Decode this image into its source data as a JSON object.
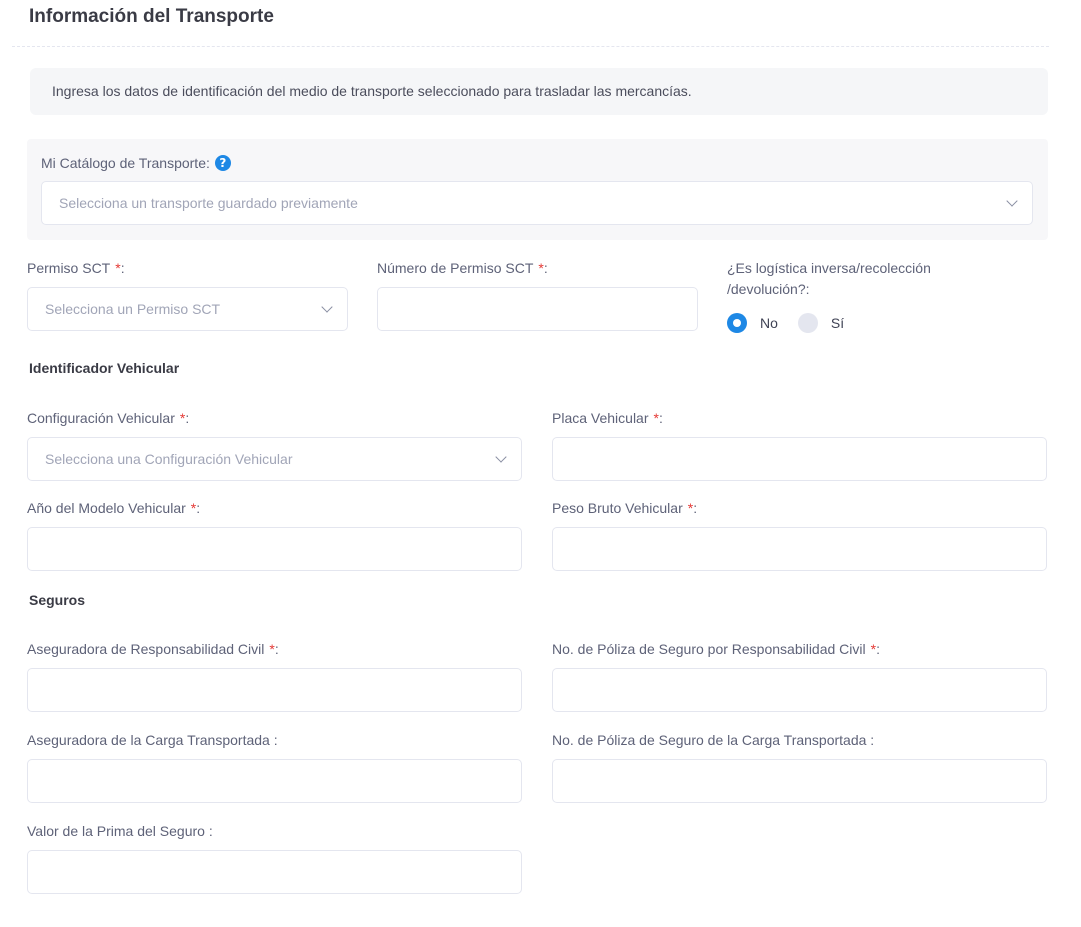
{
  "page": {
    "title": "Información del Transporte"
  },
  "notice": "Ingresa los datos de identificación del medio de transporte seleccionado para trasladar las mercancías.",
  "catalog": {
    "label": "Mi Catálogo de Transporte:",
    "help_icon": "?",
    "placeholder": "Selecciona un transporte guardado previamente"
  },
  "permiso": {
    "label": "Permiso SCT",
    "required_mark": "*",
    "colon": ":",
    "placeholder": "Selecciona un Permiso SCT"
  },
  "numero_permiso": {
    "label": "Número de Permiso SCT",
    "required_mark": "*",
    "colon": ":",
    "value": ""
  },
  "logistica": {
    "label_line1": "¿Es logística inversa/recolección",
    "label_line2": "/devolución?:",
    "options": [
      {
        "label": "No",
        "checked": true
      },
      {
        "label": "Sí",
        "checked": false
      }
    ]
  },
  "identificador": {
    "section_title": "Identificador Vehicular",
    "configuracion": {
      "label": "Configuración Vehicular",
      "required_mark": "*",
      "colon": ":",
      "placeholder": "Selecciona una Configuración Vehicular"
    },
    "placa": {
      "label": "Placa Vehicular",
      "required_mark": "*",
      "colon": ":",
      "value": ""
    },
    "anio": {
      "label": "Año del Modelo Vehicular",
      "required_mark": "*",
      "colon": ":",
      "value": ""
    },
    "peso": {
      "label": "Peso Bruto Vehicular",
      "required_mark": "*",
      "colon": ":",
      "value": ""
    }
  },
  "seguros": {
    "section_title": "Seguros",
    "aseguradora_rc": {
      "label": "Aseguradora de Responsabilidad Civil",
      "required_mark": "*",
      "colon": ":",
      "value": ""
    },
    "poliza_rc": {
      "label": "No. de Póliza de Seguro por Responsabilidad Civil",
      "required_mark": "*",
      "colon": ":",
      "value": ""
    },
    "aseguradora_carga": {
      "label": "Aseguradora de la Carga Transportada :",
      "value": ""
    },
    "poliza_carga": {
      "label": "No. de Póliza de Seguro de la Carga Transportada :",
      "value": ""
    },
    "prima": {
      "label": "Valor de la Prima del Seguro :",
      "value": ""
    }
  },
  "colors": {
    "accent": "#1e88e5",
    "required": "#e53935",
    "border": "#e4e6ef"
  }
}
